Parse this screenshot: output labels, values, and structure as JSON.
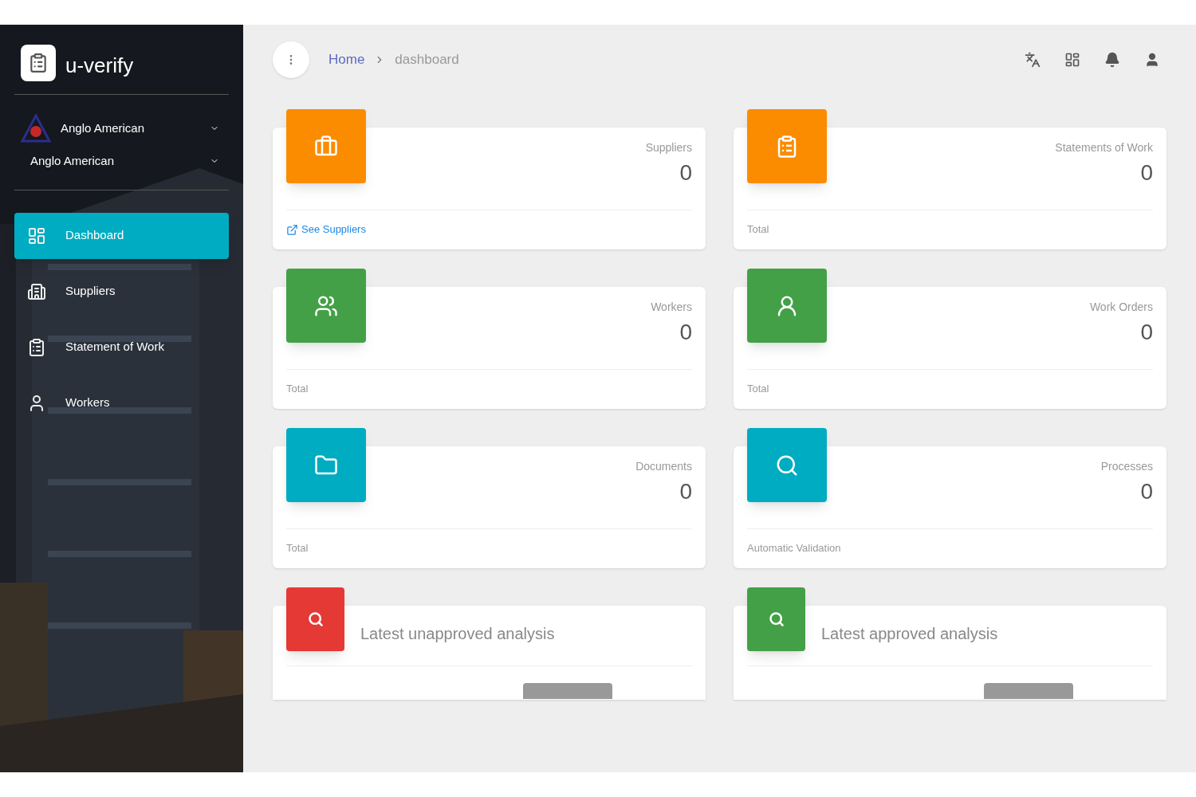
{
  "sidebar": {
    "brand": "u-verify",
    "account": {
      "name": "Anglo American"
    },
    "company": {
      "name": "Anglo American"
    },
    "items": [
      {
        "label": "Dashboard",
        "selected": true
      },
      {
        "label": "Suppliers",
        "selected": false
      },
      {
        "label": "Statement of Work",
        "selected": false
      },
      {
        "label": "Workers",
        "selected": false
      }
    ]
  },
  "breadcrumb": [
    {
      "label": "Home",
      "kind": "link"
    },
    {
      "label": "dashboard",
      "kind": "current"
    }
  ],
  "stats": [
    {
      "title": "Suppliers",
      "value": "0",
      "color": "#fb8c00",
      "footer": "See Suppliers",
      "kind": "link"
    },
    {
      "title": "Statements of Work",
      "value": "0",
      "color": "#fb8c00",
      "footer": "Total",
      "kind": "text"
    },
    {
      "title": "Workers",
      "value": "0",
      "color": "#43a047",
      "footer": "Total",
      "kind": "text"
    },
    {
      "title": "Work Orders",
      "value": "0",
      "color": "#43a047",
      "footer": "Total",
      "kind": "text"
    },
    {
      "title": "Documents",
      "value": "0",
      "color": "#00acc1",
      "footer": "Total",
      "kind": "text"
    },
    {
      "title": "Processes",
      "value": "0",
      "color": "#00acc1",
      "footer": "Automatic Validation",
      "kind": "text"
    }
  ],
  "analyses": [
    {
      "title": "Latest unapproved analysis",
      "color": "#e53935"
    },
    {
      "title": "Latest approved analysis",
      "color": "#43a047"
    }
  ]
}
